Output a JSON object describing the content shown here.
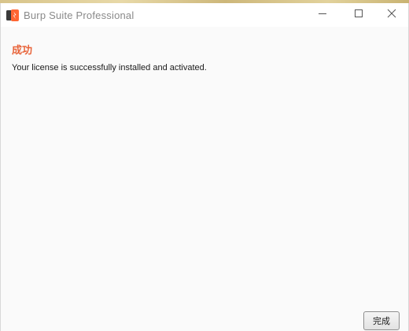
{
  "window": {
    "title": "Burp Suite Professional",
    "icon": "burp-suite-logo-icon",
    "controls": {
      "minimize_icon": "minimize-icon",
      "maximize_icon": "maximize-icon",
      "close_icon": "close-icon"
    }
  },
  "dialog": {
    "heading": "成功",
    "message": "Your license is successfully installed and activated.",
    "done_label": "完成"
  },
  "colors": {
    "heading": "#e8643a",
    "brand_orange": "#ff6633",
    "brand_dark": "#3a3a3a"
  }
}
